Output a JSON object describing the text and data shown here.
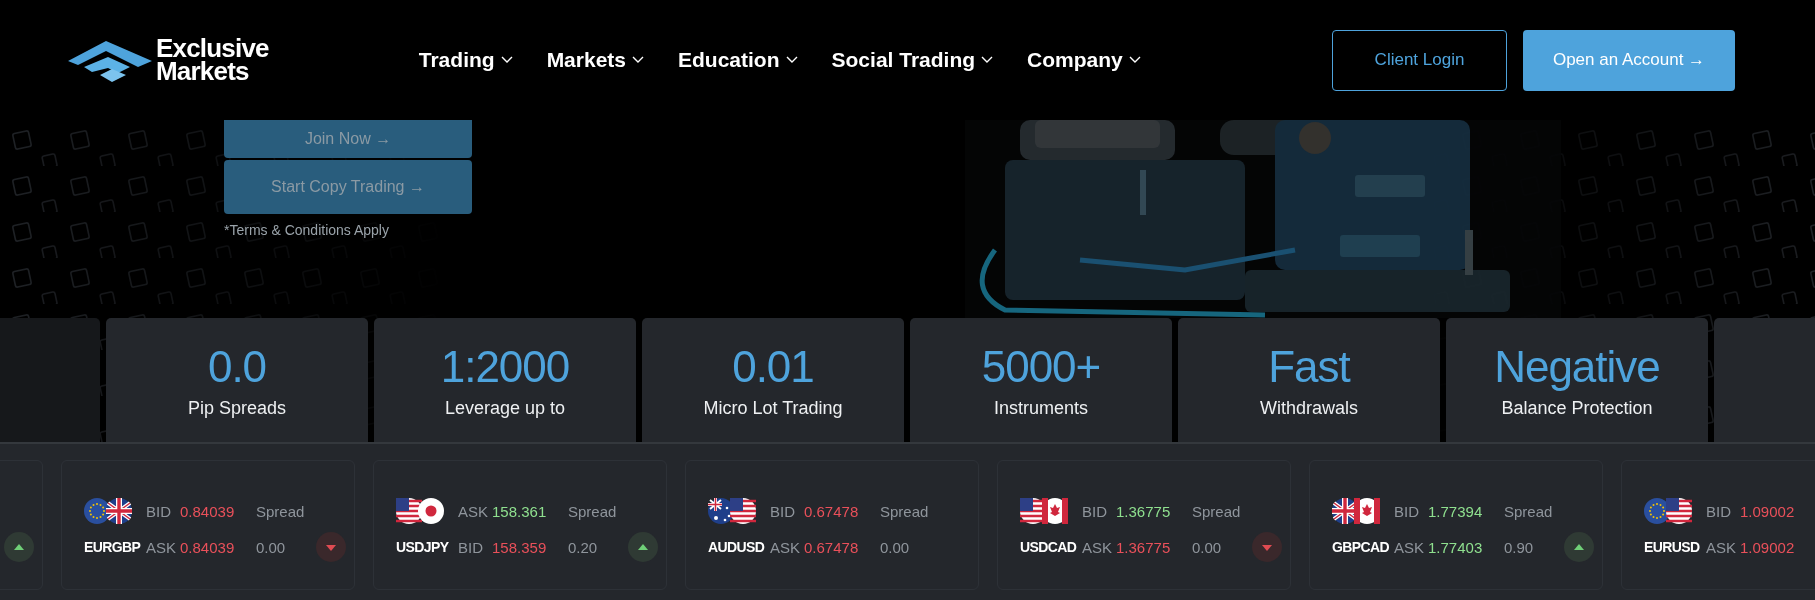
{
  "header": {
    "logo": [
      "Exclusive",
      "Markets"
    ],
    "nav": [
      {
        "label": "Trading"
      },
      {
        "label": "Markets"
      },
      {
        "label": "Education"
      },
      {
        "label": "Social Trading"
      },
      {
        "label": "Company"
      }
    ],
    "buttons": [
      {
        "label": "Client Login",
        "kind": "outline"
      },
      {
        "label": "Open an Account →",
        "kind": "filled"
      }
    ]
  },
  "hero": {
    "buttons": [
      {
        "label": "Join Now →"
      },
      {
        "label": "Start Copy Trading →"
      }
    ],
    "note": "*Terms & Conditions Apply"
  },
  "stats": [
    {
      "value": "0.0",
      "label": "Pip Spreads"
    },
    {
      "value": "1:2000",
      "label": "Leverage up to"
    },
    {
      "value": "0.01",
      "label": "Micro Lot Trading"
    },
    {
      "value": "5000+",
      "label": "Instruments"
    },
    {
      "value": "Fast",
      "label": "Withdrawals"
    },
    {
      "value": "Negative",
      "label": "Balance Protection"
    }
  ],
  "ticker": [
    {
      "badge": {
        "kind": "up"
      }
    },
    {
      "pair": "EURGBP",
      "flags": [
        {
          "kind": "eu"
        },
        {
          "kind": "gb"
        }
      ],
      "rows": [
        {
          "label": "BID",
          "value": "0.84039",
          "rising": false
        },
        {
          "label": "ASK",
          "value": "0.84039",
          "rising": false
        }
      ],
      "spread_label": "Spread",
      "spread": "0.00",
      "badge": {
        "kind": "down"
      }
    },
    {
      "pair": "USDJPY",
      "flags": [
        {
          "kind": "us"
        },
        {
          "kind": "jp"
        }
      ],
      "rows": [
        {
          "label": "ASK",
          "value": "158.361",
          "rising": true
        },
        {
          "label": "BID",
          "value": "158.359",
          "rising": false
        }
      ],
      "spread_label": "Spread",
      "spread": "0.20",
      "badge": {
        "kind": "up"
      }
    },
    {
      "pair": "AUDUSD",
      "flags": [
        {
          "kind": "au"
        },
        {
          "kind": "us"
        }
      ],
      "rows": [
        {
          "label": "BID",
          "value": "0.67478",
          "rising": false
        },
        {
          "label": "ASK",
          "value": "0.67478",
          "rising": false
        }
      ],
      "spread_label": "Spread",
      "spread": "0.00"
    },
    {
      "pair": "USDCAD",
      "flags": [
        {
          "kind": "us"
        },
        {
          "kind": "ca"
        }
      ],
      "rows": [
        {
          "label": "BID",
          "value": "1.36775",
          "rising": true
        },
        {
          "label": "ASK",
          "value": "1.36775",
          "rising": false
        }
      ],
      "spread_label": "Spread",
      "spread": "0.00",
      "badge": {
        "kind": "down"
      }
    },
    {
      "pair": "GBPCAD",
      "flags": [
        {
          "kind": "gb"
        },
        {
          "kind": "ca"
        }
      ],
      "rows": [
        {
          "label": "BID",
          "value": "1.77394",
          "rising": true
        },
        {
          "label": "ASK",
          "value": "1.77403",
          "rising": true
        }
      ],
      "spread_label": "Spread",
      "spread": "0.90",
      "badge": {
        "kind": "up"
      }
    },
    {
      "pair": "EURUSD",
      "flags": [
        {
          "kind": "eu"
        },
        {
          "kind": "us"
        }
      ],
      "rows": [
        {
          "label": "BID",
          "value": "1.09002",
          "rising": false
        },
        {
          "label": "ASK",
          "value": "1.09002",
          "rising": false
        }
      ]
    }
  ]
}
